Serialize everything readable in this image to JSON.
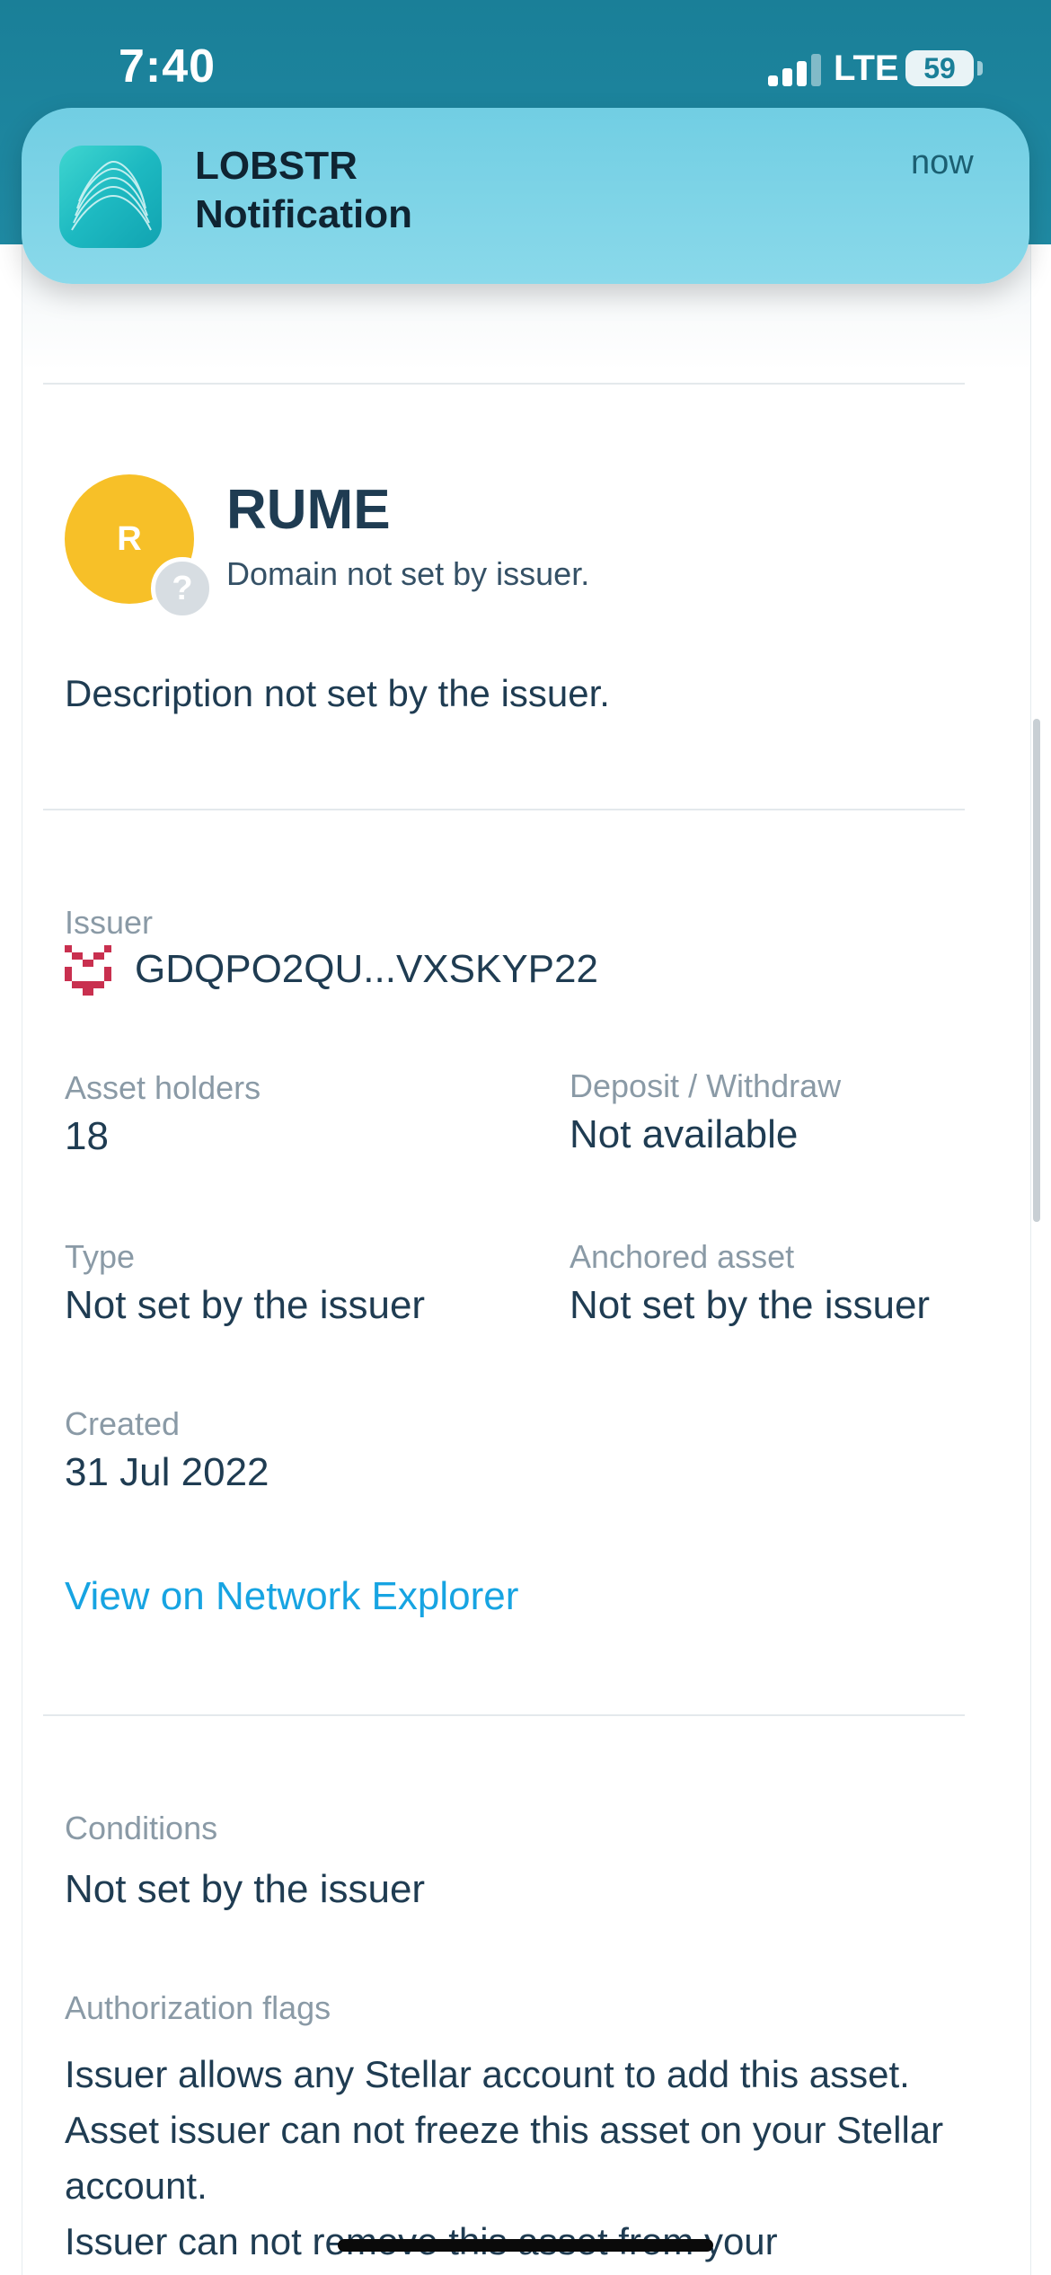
{
  "status_bar": {
    "time": "7:40",
    "network": "LTE",
    "battery": "59"
  },
  "notification": {
    "app": "LOBSTR",
    "text": "Notification",
    "time": "now"
  },
  "asset": {
    "avatar_letter": "R",
    "code": "RUME",
    "domain": "Domain not set by issuer.",
    "description": "Description not set by the issuer."
  },
  "details": {
    "issuer_label": "Issuer",
    "issuer_value": "GDQPO2QU...VXSKYP22",
    "holders_label": "Asset holders",
    "holders_value": "18",
    "deposit_label": "Deposit / Withdraw",
    "deposit_value": "Not available",
    "type_label": "Type",
    "type_value": "Not set by the issuer",
    "anchored_label": "Anchored asset",
    "anchored_value": "Not set by the issuer",
    "created_label": "Created",
    "created_value": "31 Jul 2022",
    "explorer_link": "View on Network Explorer"
  },
  "conditions": {
    "label": "Conditions",
    "value": "Not set by the issuer",
    "flags_label": "Authorization flags",
    "flags_lines": [
      "Issuer allows any Stellar account to add this asset.",
      "Asset issuer can not freeze this asset on your Stellar account.",
      "Issuer can not remove this asset from your"
    ]
  },
  "colors": {
    "header": "#1a7f98",
    "notification": "#7dd4e7",
    "avatar": "#f7c028",
    "link": "#17a4e2",
    "issuer_identicon": "#c9304f"
  }
}
